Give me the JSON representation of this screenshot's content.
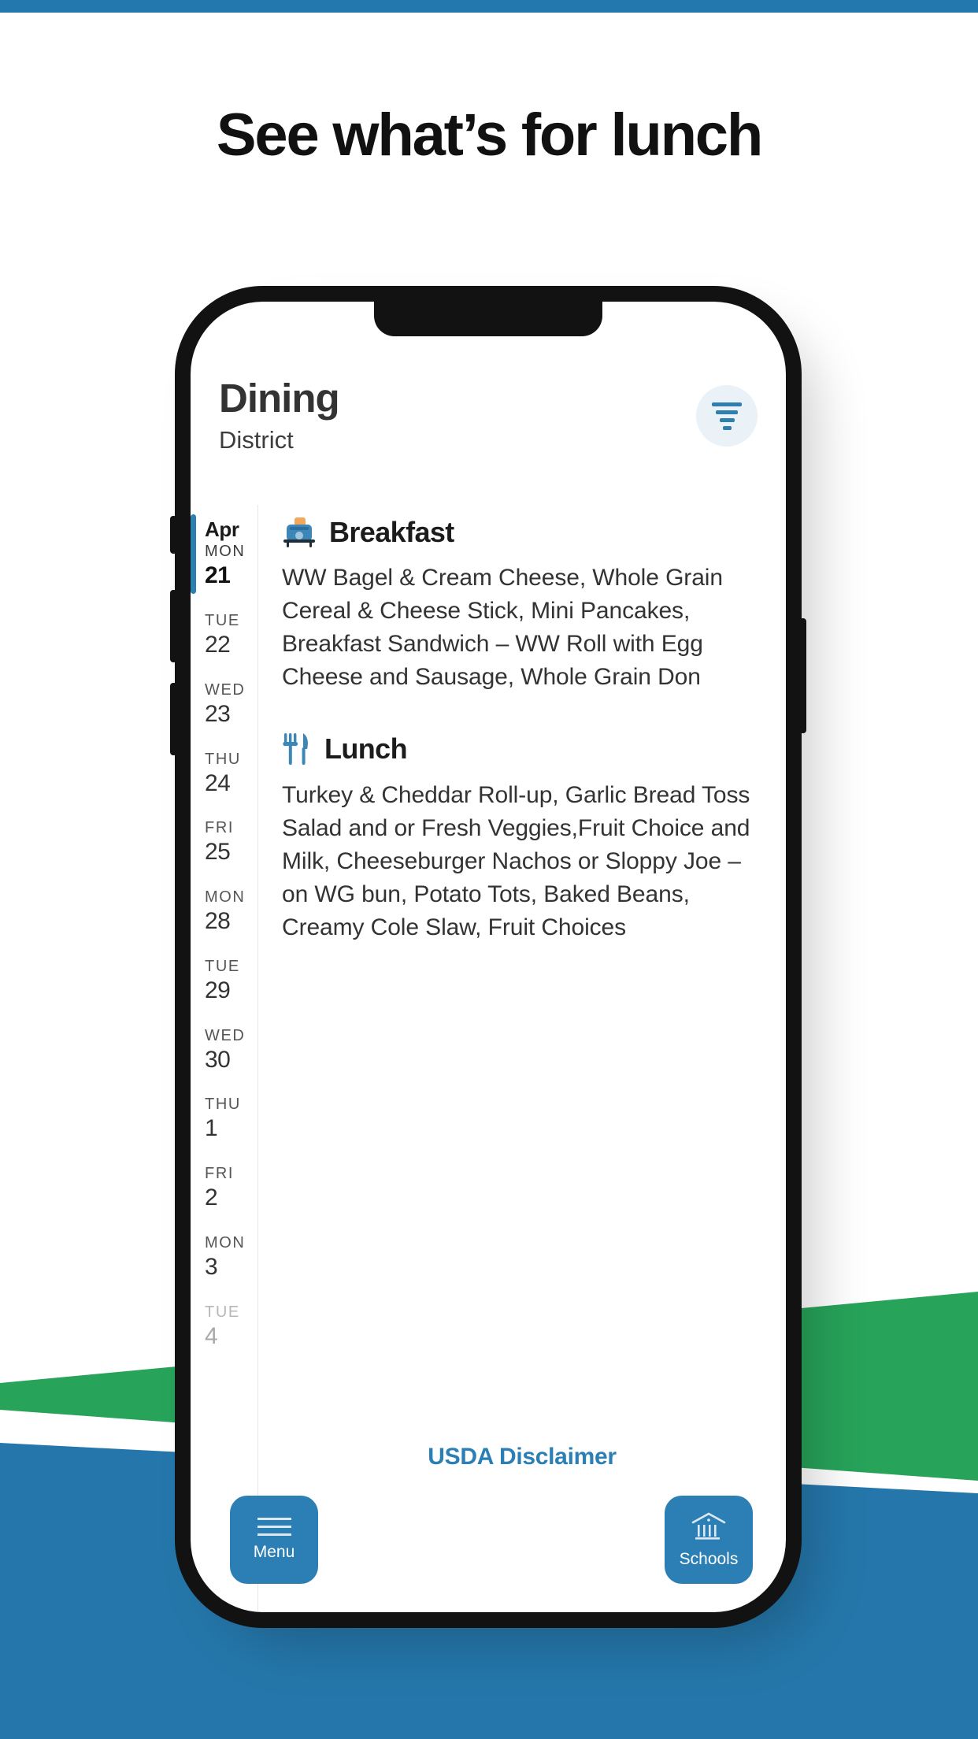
{
  "page": {
    "headline": "See what’s for lunch",
    "accent_blue": "#2379ad",
    "band_green": "#27a35a",
    "band_blue": "#2577ab"
  },
  "app": {
    "title": "Dining",
    "subtitle": "District",
    "filter_icon": "filter-icon"
  },
  "dates": [
    {
      "month": "Apr",
      "dow": "MON",
      "day": "21",
      "selected": true
    },
    {
      "month": "",
      "dow": "TUE",
      "day": "22",
      "selected": false
    },
    {
      "month": "",
      "dow": "WED",
      "day": "23",
      "selected": false
    },
    {
      "month": "",
      "dow": "THU",
      "day": "24",
      "selected": false
    },
    {
      "month": "",
      "dow": "FRI",
      "day": "25",
      "selected": false
    },
    {
      "month": "",
      "dow": "MON",
      "day": "28",
      "selected": false
    },
    {
      "month": "",
      "dow": "TUE",
      "day": "29",
      "selected": false
    },
    {
      "month": "",
      "dow": "WED",
      "day": "30",
      "selected": false
    },
    {
      "month": "",
      "dow": "THU",
      "day": "1",
      "selected": false
    },
    {
      "month": "",
      "dow": "FRI",
      "day": "2",
      "selected": false
    },
    {
      "month": "",
      "dow": "MON",
      "day": "3",
      "selected": false
    },
    {
      "month": "",
      "dow": "TUE",
      "day": "4",
      "selected": false
    }
  ],
  "meals": {
    "breakfast": {
      "name": "Breakfast",
      "icon": "toaster-icon",
      "items": "WW Bagel & Cream Cheese, Whole Grain Cereal & Cheese Stick, Mini Pancakes, Breakfast Sandwich – WW Roll with Egg Cheese and Sausage, Whole Grain Don"
    },
    "lunch": {
      "name": "Lunch",
      "icon": "fork-knife-icon",
      "items": "Turkey & Cheddar Roll-up, Garlic Bread Toss Salad and or Fresh Veggies,Fruit Choice and Milk, Cheeseburger Nachos or Sloppy Joe – on WG bun, Potato Tots, Baked Beans, Creamy Cole Slaw, Fruit Choices"
    }
  },
  "footer": {
    "disclaimer_label": "USDA Disclaimer",
    "menu_label": "Menu",
    "schools_label": "Schools"
  }
}
